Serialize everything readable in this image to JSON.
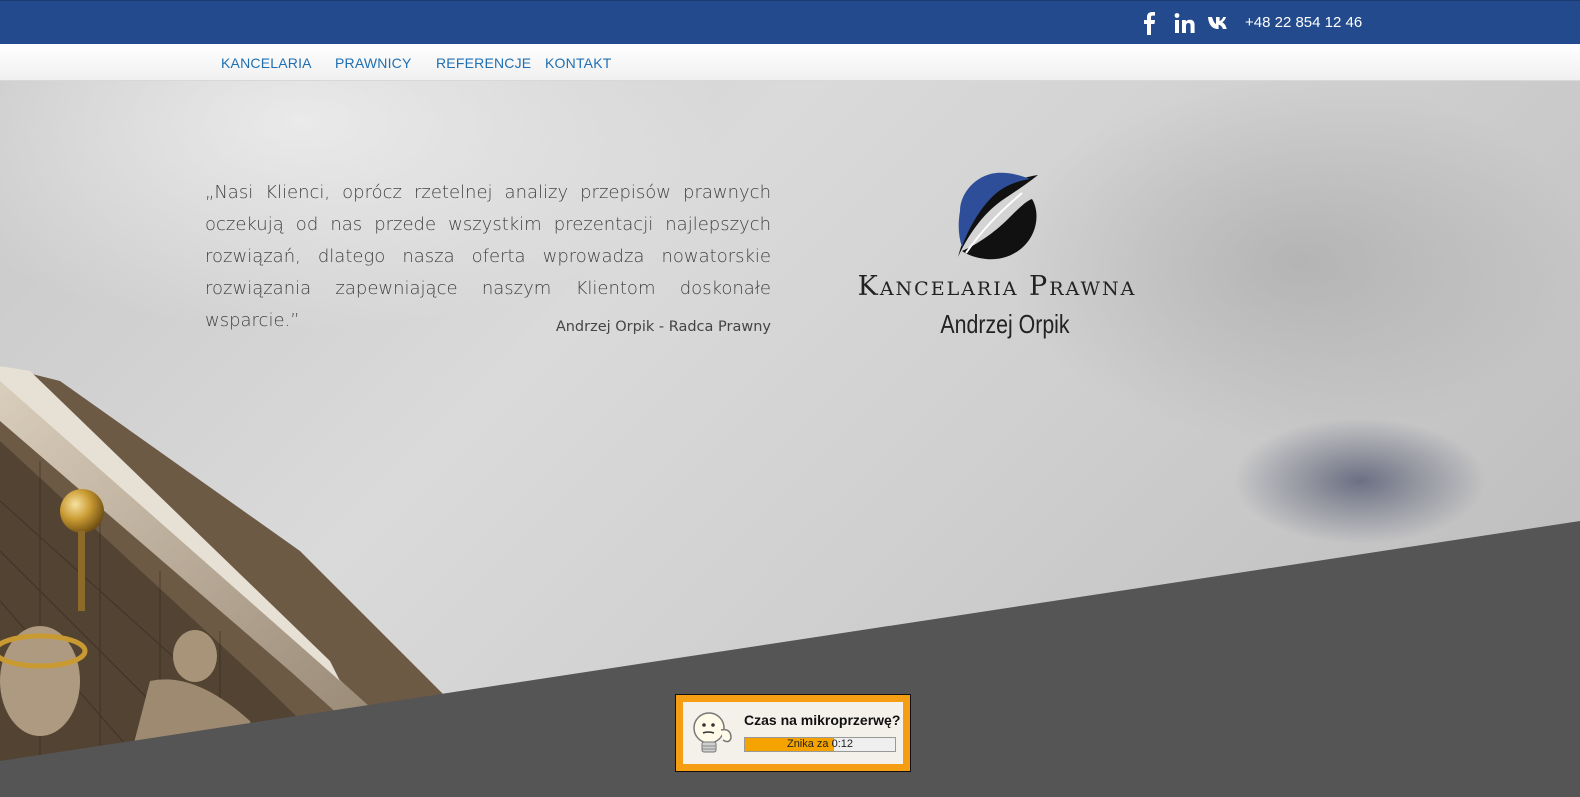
{
  "header": {
    "social": [
      {
        "name": "facebook",
        "icon": "facebook-icon"
      },
      {
        "name": "linkedin",
        "icon": "linkedin-icon"
      },
      {
        "name": "vk",
        "icon": "vk-icon"
      }
    ],
    "phone": "+48 22 854 12 46"
  },
  "nav": {
    "items": [
      {
        "label": "KANCELARIA"
      },
      {
        "label": "PRAWNICY"
      },
      {
        "label": "REFERENCJE"
      },
      {
        "label": "KONTAKT"
      }
    ]
  },
  "hero": {
    "quote": "„Nasi Klienci, oprócz rzetelnej analizy przepisów prawnych oczekują od nas przede wszystkim prezentacji najlepszych rozwiązań, dlatego nasza oferta wprowadza nowatorskie rozwiązania zapewniające naszym Klientom doskonałe wsparcie.”",
    "author": "Andrzej Orpik - Radca Prawny",
    "logo": {
      "title": "Kancelaria Prawna",
      "subtitle": "Andrzej Orpik",
      "icon": "quill-logo-icon"
    }
  },
  "popup": {
    "title": "Czas na mikroprzerwę?",
    "countdown_label": "Znika za 0:12",
    "progress_fraction": 0.59,
    "icon": "lightbulb-icon"
  },
  "colors": {
    "topbar": "#234a8c",
    "nav_link": "#1f6fb2",
    "popup_border": "#f59d13",
    "diagonal_band": "#555555"
  }
}
